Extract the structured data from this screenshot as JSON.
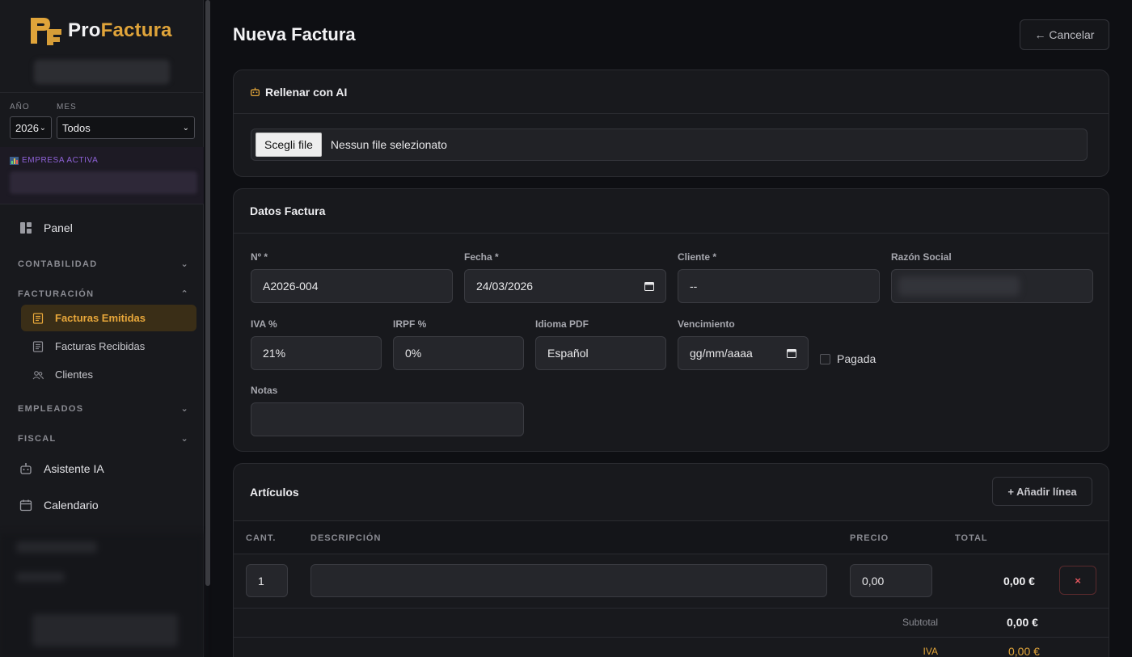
{
  "brand": {
    "name_part1": "Pro",
    "name_part2": "Factura",
    "accent": "#e0a43a"
  },
  "filters": {
    "year_label": "AÑO",
    "year_value": "2026",
    "month_label": "MES",
    "month_value": "Todos"
  },
  "empresa": {
    "label": "EMPRESA ACTIVA"
  },
  "nav": {
    "panel": "Panel",
    "contabilidad": "CONTABILIDAD",
    "facturacion": "FACTURACIÓN",
    "facturacion_items": [
      "Facturas Emitidas",
      "Facturas Recibidas",
      "Clientes"
    ],
    "empleados": "EMPLEADOS",
    "fiscal": "FISCAL",
    "asistente": "Asistente IA",
    "calendario": "Calendario"
  },
  "page": {
    "title": "Nueva Factura",
    "cancel_label": "← Cancelar"
  },
  "ai_card": {
    "title": "Rellenar con AI",
    "file_button": "Scegli file",
    "file_status": "Nessun file selezionato"
  },
  "datos": {
    "title": "Datos Factura",
    "numero_label": "Nº *",
    "numero_value": "A2026-004",
    "fecha_label": "Fecha *",
    "fecha_value": "24/03/2026",
    "cliente_label": "Cliente *",
    "cliente_value": "--",
    "razon_label": "Razón Social",
    "iva_label": "IVA %",
    "iva_value": "21%",
    "irpf_label": "IRPF %",
    "irpf_value": "0%",
    "idioma_label": "Idioma PDF",
    "idioma_value": "Español",
    "venc_label": "Vencimiento",
    "venc_placeholder": "gg/mm/aaaa",
    "pagada_label": "Pagada",
    "notas_label": "Notas"
  },
  "articulos": {
    "title": "Artículos",
    "add_label": "+ Añadir línea",
    "headers": {
      "cant": "CANT.",
      "desc": "DESCRIPCIÓN",
      "precio": "PRECIO",
      "total": "TOTAL"
    },
    "rows": [
      {
        "cant": "1",
        "desc": "",
        "precio": "0,00",
        "total": "0,00 €"
      }
    ],
    "remove_label": "×",
    "subtotal_label": "Subtotal",
    "subtotal_value": "0,00 €",
    "iva_label": "IVA",
    "iva_value": "0,00 €"
  }
}
